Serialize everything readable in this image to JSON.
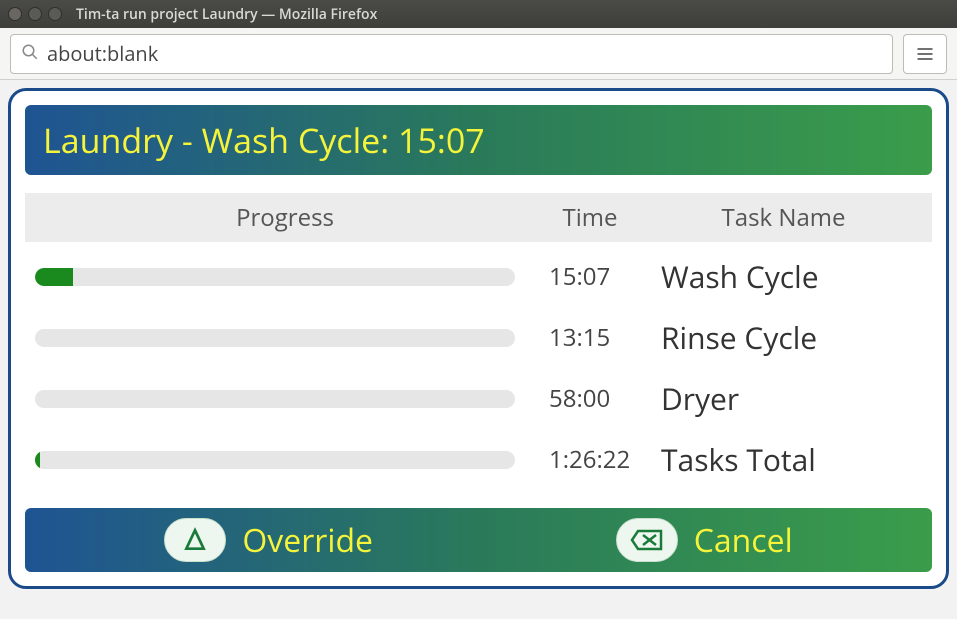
{
  "window": {
    "title": "Tim-ta run project Laundry — Mozilla Firefox"
  },
  "toolbar": {
    "url": "about:blank"
  },
  "card": {
    "title": "Laundry - Wash Cycle: 15:07"
  },
  "headers": {
    "progress": "Progress",
    "time": "Time",
    "task": "Task Name"
  },
  "rows": [
    {
      "progress_pct": 8,
      "time": "15:07",
      "name": "Wash Cycle"
    },
    {
      "progress_pct": 0,
      "time": "13:15",
      "name": "Rinse Cycle"
    },
    {
      "progress_pct": 0,
      "time": "58:00",
      "name": "Dryer"
    },
    {
      "progress_pct": 1,
      "time": "1:26:22",
      "name": "Tasks Total"
    }
  ],
  "actions": {
    "override": "Override",
    "cancel": "Cancel"
  }
}
